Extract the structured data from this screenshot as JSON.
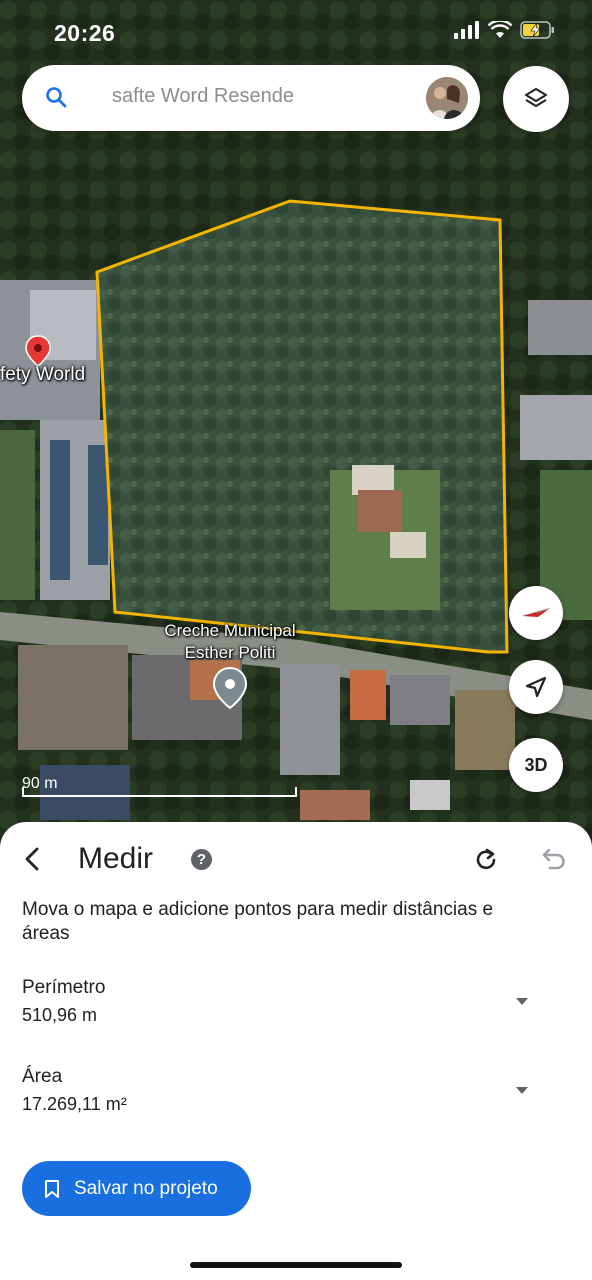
{
  "status_bar": {
    "time": "20:26"
  },
  "search": {
    "text": "safte Word Resende"
  },
  "map": {
    "labels": {
      "safety_world": "fety World",
      "creche_line1": "Creche Municipal",
      "creche_line2": "Esther Politi"
    },
    "scale": "90 m",
    "three_d": "3D",
    "polygon_color": "#f4b400"
  },
  "sheet": {
    "title": "Medir",
    "help": "?",
    "description": "Mova o mapa e adicione pontos para medir distâncias e áreas",
    "perimeter": {
      "label": "Perímetro",
      "value": "510,96 m"
    },
    "area": {
      "label": "Área",
      "value": "17.269,11 m²"
    },
    "save_label": "Salvar no projeto"
  },
  "colors": {
    "accent": "#1a6fe0",
    "marker_red": "#e53935"
  }
}
